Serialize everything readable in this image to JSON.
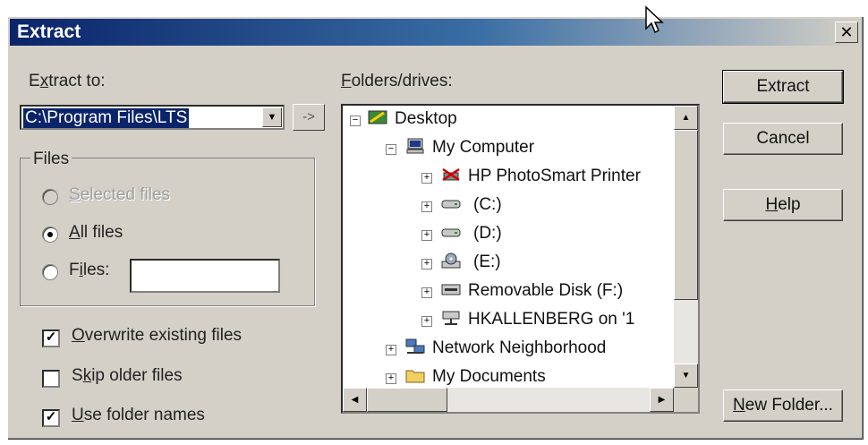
{
  "window": {
    "title": "Extract",
    "close_glyph": "✕"
  },
  "extract_to": {
    "label_pre": "E",
    "label_u": "x",
    "label_post": "tract to:",
    "value": "C:\\Program Files\\LTS",
    "arrow_button": "->"
  },
  "files_group": {
    "title": "Files",
    "selected": {
      "u": "S",
      "rest": "elected files",
      "checked": false,
      "enabled": false
    },
    "all": {
      "u": "A",
      "rest": "ll files",
      "checked": true
    },
    "files": {
      "pre": "F",
      "u": "i",
      "rest": "les:",
      "value": ""
    }
  },
  "options": {
    "overwrite": {
      "u": "O",
      "rest": "verwrite existing files",
      "checked": true
    },
    "skip": {
      "pre": "S",
      "u": "k",
      "rest": "ip older files",
      "checked": false
    },
    "use_folder": {
      "u": "U",
      "rest": "se folder names",
      "checked": true
    }
  },
  "folders": {
    "label_u": "F",
    "label_rest": "olders/drives:",
    "tree": [
      {
        "label": "Desktop",
        "expander": "−",
        "icon": "desktop-icon"
      },
      {
        "label": "My Computer",
        "expander": "−",
        "icon": "computer-icon"
      },
      {
        "label": "HP PhotoSmart Printer",
        "expander": "+",
        "icon": "printer-icon"
      },
      {
        "label": "(C:)",
        "expander": "+",
        "icon": "drive-icon"
      },
      {
        "label": "(D:)",
        "expander": "+",
        "icon": "drive-icon"
      },
      {
        "label": "(E:)",
        "expander": "+",
        "icon": "cdrom-icon"
      },
      {
        "label": "Removable Disk (F:)",
        "expander": "+",
        "icon": "removable-drive-icon"
      },
      {
        "label": "HKALLENBERG on '1",
        "expander": "+",
        "icon": "network-drive-icon"
      },
      {
        "label": "Network Neighborhood",
        "expander": "+",
        "icon": "network-icon"
      },
      {
        "label": "My Documents",
        "expander": "+",
        "icon": "folder-icon"
      }
    ]
  },
  "buttons": {
    "extract": "Extract",
    "cancel": "Cancel",
    "help_u": "H",
    "help_rest": "elp",
    "newfolder_u": "N",
    "newfolder_rest": "ew Folder..."
  }
}
